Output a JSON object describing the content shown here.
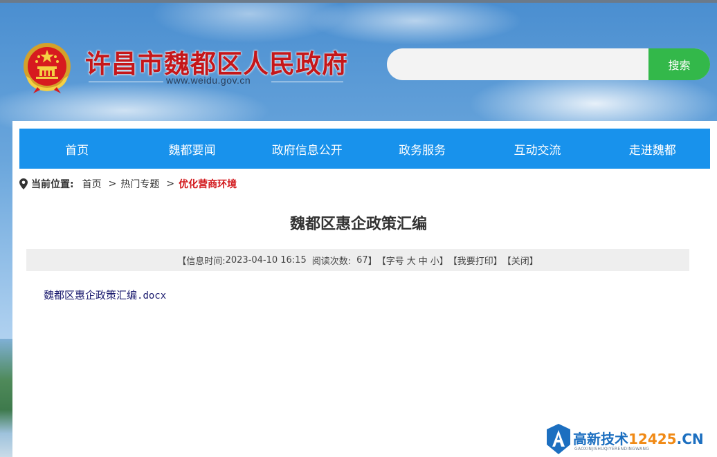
{
  "header": {
    "site_title": "许昌市魏都区人民政府",
    "site_url": "www.weidu.gov.cn"
  },
  "search": {
    "placeholder": "",
    "value": "",
    "button_label": "搜索"
  },
  "nav": {
    "items": [
      {
        "label": "首页"
      },
      {
        "label": "魏都要闻"
      },
      {
        "label": "政府信息公开"
      },
      {
        "label": "政务服务"
      },
      {
        "label": "互动交流"
      },
      {
        "label": "走进魏都"
      }
    ]
  },
  "breadcrumb": {
    "label": "当前位置:",
    "items": [
      "首页",
      "热门专题",
      "优化营商环境"
    ],
    "separator": ">"
  },
  "article": {
    "title": "魏都区惠企政策汇编",
    "meta": {
      "time_label": "【信息时间:",
      "time_value": "2023-04-10 16:15",
      "reads_label": "阅读次数:",
      "reads_value": "67",
      "reads_close": "】",
      "font_size_open": "【字号",
      "font_large": "大",
      "font_medium": "中",
      "font_small": "小",
      "font_size_close": "】",
      "print": "【我要打印】",
      "close": "【关闭】"
    },
    "attachment_name": "魏都区惠企政策汇编",
    "attachment_ext": ".docx"
  },
  "watermark": {
    "text": "高新技术",
    "number": "12425",
    "domain": ".CN",
    "subtext": "GAOXINJISHUQIYERENDINGWANG"
  },
  "colors": {
    "nav_bg": "#1892ec",
    "search_button": "#33b84a",
    "title_red": "#c5171a",
    "current_crumb": "#d2181c",
    "meta_bg": "#eeeeee"
  }
}
